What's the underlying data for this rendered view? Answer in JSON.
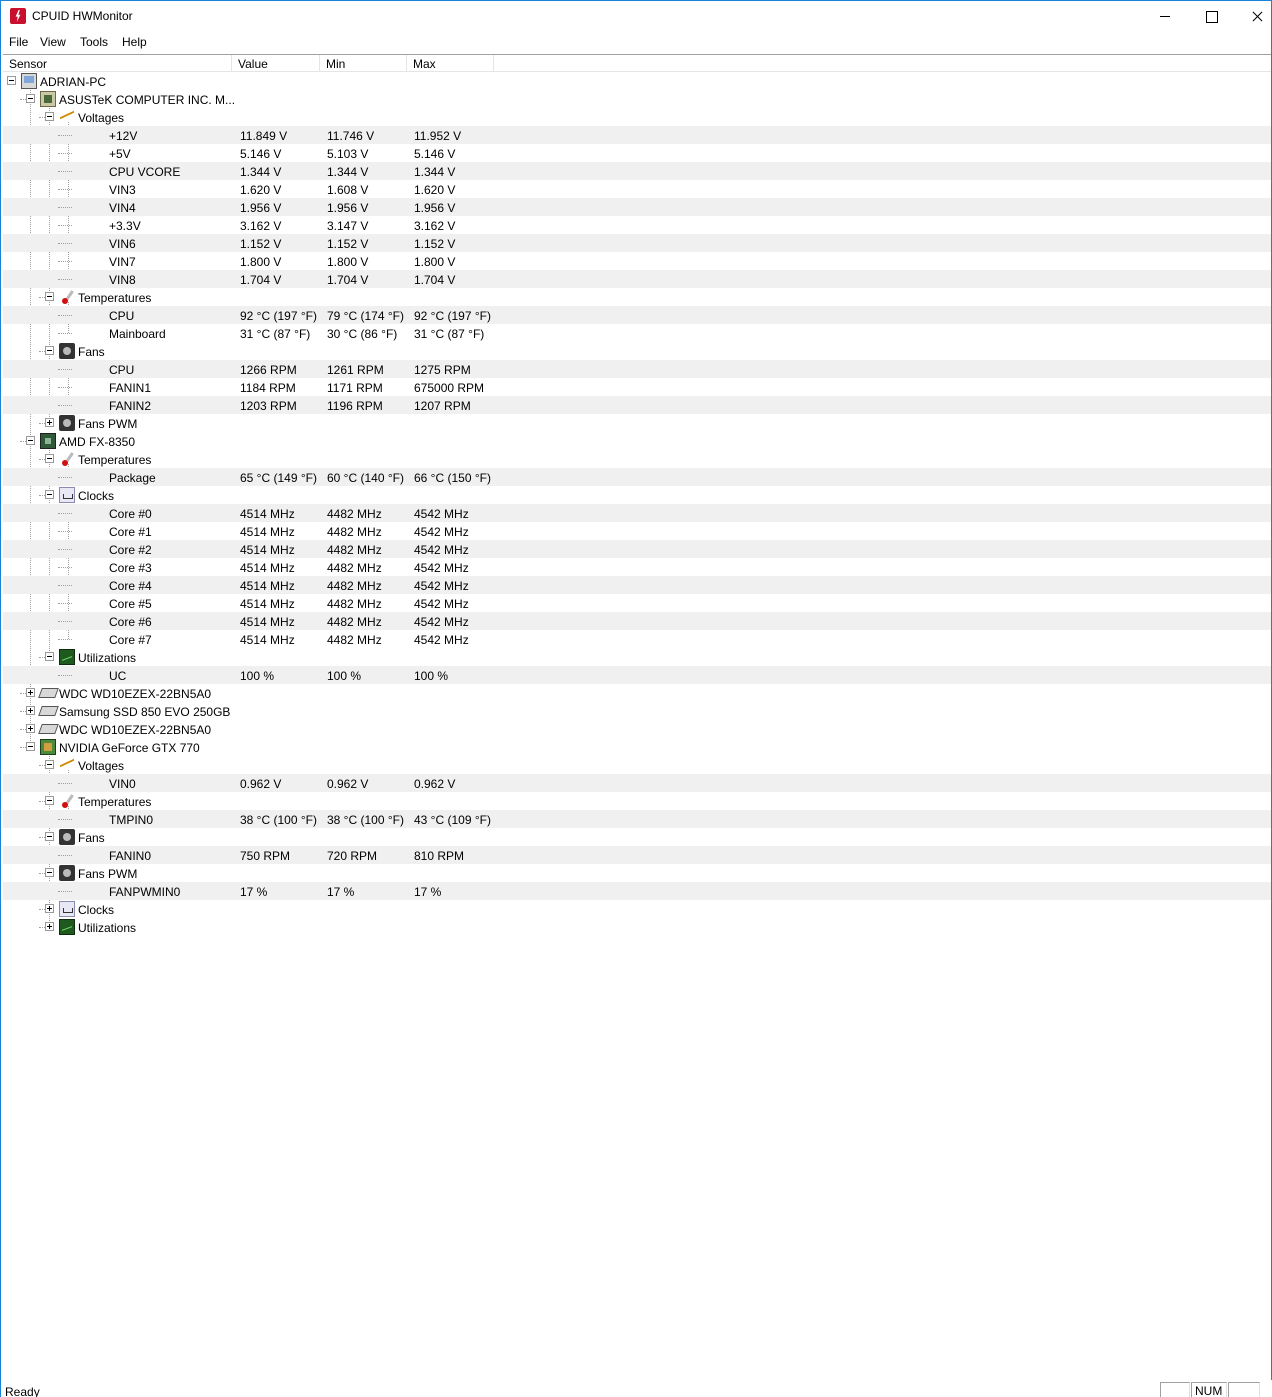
{
  "window": {
    "title": "CPUID HWMonitor"
  },
  "menu": [
    "File",
    "View",
    "Tools",
    "Help"
  ],
  "columns": [
    "Sensor",
    "Value",
    "Min",
    "Max"
  ],
  "rows": [
    {
      "level": 0,
      "kind": "node",
      "icon": "computer-icon",
      "expander": "minus",
      "name": "ADRIAN-PC"
    },
    {
      "level": 1,
      "kind": "node",
      "icon": "motherboard-icon",
      "expander": "minus",
      "name": "ASUSTeK COMPUTER INC. M..."
    },
    {
      "level": 2,
      "kind": "node",
      "icon": "voltage-icon",
      "expander": "minus",
      "name": "Voltages"
    },
    {
      "level": 3,
      "kind": "leaf",
      "name": "+12V",
      "value": "11.849 V",
      "min": "11.746 V",
      "max": "11.952 V"
    },
    {
      "level": 3,
      "kind": "leaf",
      "name": "+5V",
      "value": "5.146 V",
      "min": "5.103 V",
      "max": "5.146 V"
    },
    {
      "level": 3,
      "kind": "leaf",
      "name": "CPU VCORE",
      "value": "1.344 V",
      "min": "1.344 V",
      "max": "1.344 V"
    },
    {
      "level": 3,
      "kind": "leaf",
      "name": "VIN3",
      "value": "1.620 V",
      "min": "1.608 V",
      "max": "1.620 V"
    },
    {
      "level": 3,
      "kind": "leaf",
      "name": "VIN4",
      "value": "1.956 V",
      "min": "1.956 V",
      "max": "1.956 V"
    },
    {
      "level": 3,
      "kind": "leaf",
      "name": "+3.3V",
      "value": "3.162 V",
      "min": "3.147 V",
      "max": "3.162 V"
    },
    {
      "level": 3,
      "kind": "leaf",
      "name": "VIN6",
      "value": "1.152 V",
      "min": "1.152 V",
      "max": "1.152 V"
    },
    {
      "level": 3,
      "kind": "leaf",
      "name": "VIN7",
      "value": "1.800 V",
      "min": "1.800 V",
      "max": "1.800 V"
    },
    {
      "level": 3,
      "kind": "leaf",
      "name": "VIN8",
      "value": "1.704 V",
      "min": "1.704 V",
      "max": "1.704 V"
    },
    {
      "level": 2,
      "kind": "node",
      "icon": "thermometer-icon",
      "expander": "minus",
      "name": "Temperatures"
    },
    {
      "level": 3,
      "kind": "leaf",
      "name": "CPU",
      "value": "92 °C  (197 °F)",
      "min": "79 °C  (174 °F)",
      "max": "92 °C  (197 °F)"
    },
    {
      "level": 3,
      "kind": "leaf",
      "name": "Mainboard",
      "value": "31 °C  (87 °F)",
      "min": "30 °C  (86 °F)",
      "max": "31 °C  (87 °F)"
    },
    {
      "level": 2,
      "kind": "node",
      "icon": "fan-icon",
      "expander": "minus",
      "name": "Fans"
    },
    {
      "level": 3,
      "kind": "leaf",
      "name": "CPU",
      "value": "1266 RPM",
      "min": "1261 RPM",
      "max": "1275 RPM"
    },
    {
      "level": 3,
      "kind": "leaf",
      "name": "FANIN1",
      "value": "1184 RPM",
      "min": "1171 RPM",
      "max": "675000 RPM"
    },
    {
      "level": 3,
      "kind": "leaf",
      "name": "FANIN2",
      "value": "1203 RPM",
      "min": "1196 RPM",
      "max": "1207 RPM"
    },
    {
      "level": 2,
      "kind": "node",
      "icon": "fan-pwm-icon",
      "expander": "plus",
      "name": "Fans PWM"
    },
    {
      "level": 1,
      "kind": "node",
      "icon": "cpu-icon",
      "expander": "minus",
      "name": "AMD FX-8350"
    },
    {
      "level": 2,
      "kind": "node",
      "icon": "thermometer-icon",
      "expander": "minus",
      "name": "Temperatures"
    },
    {
      "level": 3,
      "kind": "leaf",
      "name": "Package",
      "value": "65 °C  (149 °F)",
      "min": "60 °C  (140 °F)",
      "max": "66 °C  (150 °F)"
    },
    {
      "level": 2,
      "kind": "node",
      "icon": "clock-icon",
      "expander": "minus",
      "name": "Clocks"
    },
    {
      "level": 3,
      "kind": "leaf",
      "name": "Core #0",
      "value": "4514 MHz",
      "min": "4482 MHz",
      "max": "4542 MHz"
    },
    {
      "level": 3,
      "kind": "leaf",
      "name": "Core #1",
      "value": "4514 MHz",
      "min": "4482 MHz",
      "max": "4542 MHz"
    },
    {
      "level": 3,
      "kind": "leaf",
      "name": "Core #2",
      "value": "4514 MHz",
      "min": "4482 MHz",
      "max": "4542 MHz"
    },
    {
      "level": 3,
      "kind": "leaf",
      "name": "Core #3",
      "value": "4514 MHz",
      "min": "4482 MHz",
      "max": "4542 MHz"
    },
    {
      "level": 3,
      "kind": "leaf",
      "name": "Core #4",
      "value": "4514 MHz",
      "min": "4482 MHz",
      "max": "4542 MHz"
    },
    {
      "level": 3,
      "kind": "leaf",
      "name": "Core #5",
      "value": "4514 MHz",
      "min": "4482 MHz",
      "max": "4542 MHz"
    },
    {
      "level": 3,
      "kind": "leaf",
      "name": "Core #6",
      "value": "4514 MHz",
      "min": "4482 MHz",
      "max": "4542 MHz"
    },
    {
      "level": 3,
      "kind": "leaf",
      "name": "Core #7",
      "value": "4514 MHz",
      "min": "4482 MHz",
      "max": "4542 MHz"
    },
    {
      "level": 2,
      "kind": "node",
      "icon": "utilization-icon",
      "expander": "minus",
      "name": "Utilizations"
    },
    {
      "level": 3,
      "kind": "leaf",
      "name": "UC",
      "value": "100 %",
      "min": "100 %",
      "max": "100 %"
    },
    {
      "level": 1,
      "kind": "node",
      "icon": "disk-icon",
      "expander": "plus",
      "name": "WDC WD10EZEX-22BN5A0"
    },
    {
      "level": 1,
      "kind": "node",
      "icon": "disk-icon",
      "expander": "plus",
      "name": "Samsung SSD 850 EVO 250GB"
    },
    {
      "level": 1,
      "kind": "node",
      "icon": "disk-icon",
      "expander": "plus",
      "name": "WDC WD10EZEX-22BN5A0"
    },
    {
      "level": 1,
      "kind": "node",
      "icon": "gpu-icon",
      "expander": "minus",
      "name": "NVIDIA GeForce GTX 770"
    },
    {
      "level": 2,
      "kind": "node",
      "icon": "voltage-icon",
      "expander": "minus",
      "name": "Voltages"
    },
    {
      "level": 3,
      "kind": "leaf",
      "name": "VIN0",
      "value": "0.962 V",
      "min": "0.962 V",
      "max": "0.962 V"
    },
    {
      "level": 2,
      "kind": "node",
      "icon": "thermometer-icon",
      "expander": "minus",
      "name": "Temperatures"
    },
    {
      "level": 3,
      "kind": "leaf",
      "name": "TMPIN0",
      "value": "38 °C  (100 °F)",
      "min": "38 °C  (100 °F)",
      "max": "43 °C  (109 °F)"
    },
    {
      "level": 2,
      "kind": "node",
      "icon": "fan-icon",
      "expander": "minus",
      "name": "Fans"
    },
    {
      "level": 3,
      "kind": "leaf",
      "name": "FANIN0",
      "value": "750 RPM",
      "min": "720 RPM",
      "max": "810 RPM"
    },
    {
      "level": 2,
      "kind": "node",
      "icon": "fan-pwm-icon",
      "expander": "minus",
      "name": "Fans PWM"
    },
    {
      "level": 3,
      "kind": "leaf",
      "name": "FANPWMIN0",
      "value": "17 %",
      "min": "17 %",
      "max": "17 %"
    },
    {
      "level": 2,
      "kind": "node",
      "icon": "clock-icon",
      "expander": "plus",
      "name": "Clocks"
    },
    {
      "level": 2,
      "kind": "node",
      "icon": "utilization-icon",
      "expander": "plus",
      "name": "Utilizations"
    }
  ],
  "status": {
    "text": "Ready",
    "num": "NUM"
  }
}
